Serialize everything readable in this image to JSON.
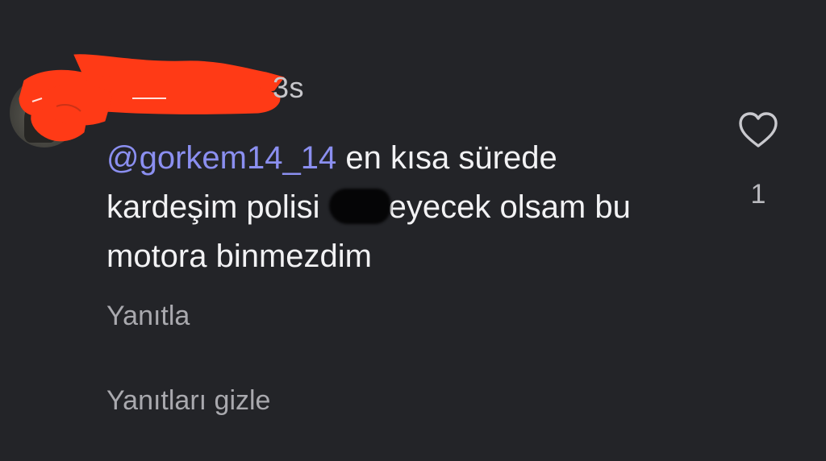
{
  "comment": {
    "timestamp": "3s",
    "mention": "@gorkem14_14",
    "text_line1": " en kısa sürede",
    "text_line2_before": "kardeşim polisi ",
    "text_line2_after": "eyecek olsam bu",
    "text_line3": "motora binmezdim"
  },
  "actions": {
    "reply_label": "Yanıtla",
    "hide_replies_label": "Yanıtları gizle"
  },
  "like": {
    "icon": "heart-outline-icon",
    "count": "1"
  },
  "colors": {
    "background": "#232428",
    "text": "#f2f2f4",
    "mention": "#8b8ff0",
    "muted": "#a9a9ae",
    "redaction": "#ff3a16"
  }
}
